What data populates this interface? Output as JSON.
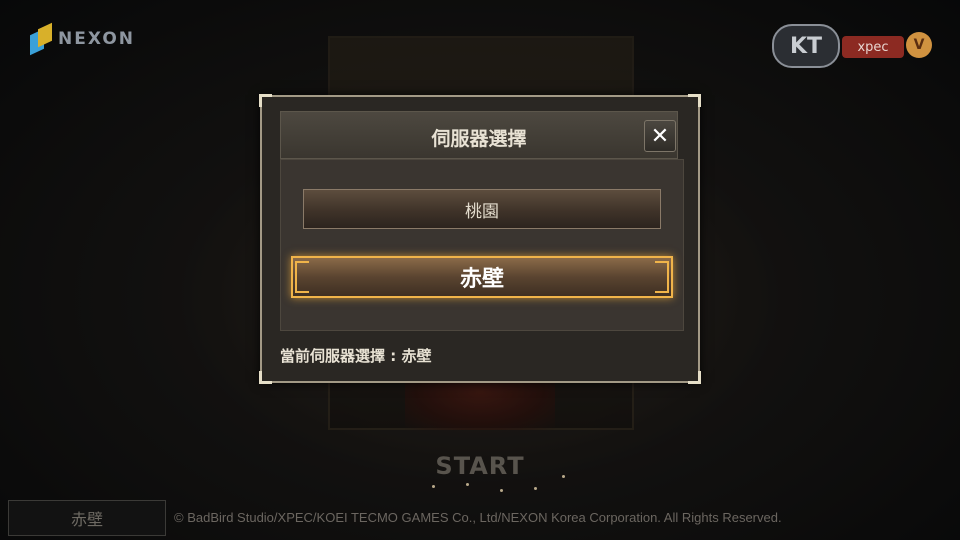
{
  "brand": {
    "nexon": "NEXON",
    "kt": "KT",
    "xpec": "xpec",
    "xpec_badge": "V"
  },
  "background": {
    "start_label": "START"
  },
  "footer": {
    "selected_server": "赤壁",
    "copyright": "© BadBird Studio/XPEC/KOEI TECMO GAMES Co., Ltd/NEXON Korea Corporation. All Rights Reserved."
  },
  "dialog": {
    "title": "伺服器選擇",
    "close_label": "✕",
    "servers": [
      {
        "label": "桃園",
        "selected": false
      },
      {
        "label": "赤壁",
        "selected": true
      }
    ],
    "current_server_text": "當前伺服器選擇 : 赤壁"
  },
  "colors": {
    "highlight": "#f0b44a",
    "dialog_border": "#a39a86"
  }
}
